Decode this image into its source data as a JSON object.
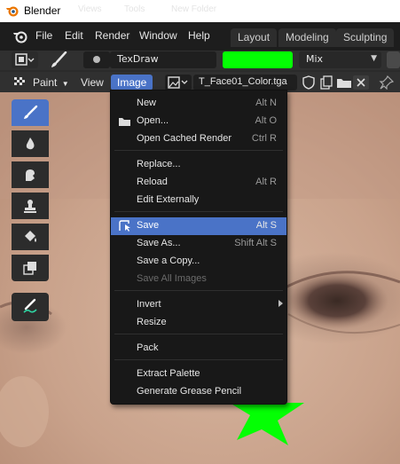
{
  "window": {
    "title": "Blender",
    "ghost_labels": [
      "Views",
      "Tools",
      "New Folder"
    ]
  },
  "topbar": {
    "menus": [
      "File",
      "Edit",
      "Render",
      "Window",
      "Help"
    ],
    "workspace_tabs": [
      "Layout",
      "Modeling",
      "Sculpting"
    ]
  },
  "tool_settings": {
    "brush_name": "TexDraw",
    "brush_color": "#04ff04",
    "blend_mode": "Mix",
    "blend_options": [
      "Mix"
    ]
  },
  "editor_header": {
    "mode": "Paint",
    "view_menu": "View",
    "image_menu": "Image",
    "image_name": "T_Face01_Color.tga"
  },
  "toolshelf": {
    "tools": [
      "Draw",
      "Soften",
      "Smear",
      "Clone",
      "Fill",
      "Mask",
      "Annotate"
    ]
  },
  "image_menu": {
    "items": [
      {
        "label": "New",
        "shortcut": "Alt N"
      },
      {
        "label": "Open...",
        "shortcut": "Alt O",
        "icon": "folder-icon"
      },
      {
        "label": "Open Cached Render",
        "shortcut": "Ctrl R"
      },
      {
        "label": "Replace...",
        "shortcut": ""
      },
      {
        "label": "Reload",
        "shortcut": "Alt R"
      },
      {
        "label": "Edit Externally",
        "shortcut": ""
      },
      {
        "label": "Save",
        "shortcut": "Alt S",
        "highlighted": true,
        "icon": "save-cursor-icon"
      },
      {
        "label": "Save As...",
        "shortcut": "Shift Alt S"
      },
      {
        "label": "Save a Copy...",
        "shortcut": ""
      },
      {
        "label": "Save All Images",
        "shortcut": "",
        "disabled": true
      },
      {
        "label": "Invert",
        "shortcut": "",
        "submenu": true
      },
      {
        "label": "Resize",
        "shortcut": ""
      },
      {
        "label": "Pack",
        "shortcut": ""
      },
      {
        "label": "Extract Palette",
        "shortcut": ""
      },
      {
        "label": "Generate Grease Pencil",
        "shortcut": ""
      }
    ]
  },
  "colors": {
    "accent": "#4a73c7",
    "menu_bg": "#181818",
    "paint_stroke": "#04ff04"
  }
}
